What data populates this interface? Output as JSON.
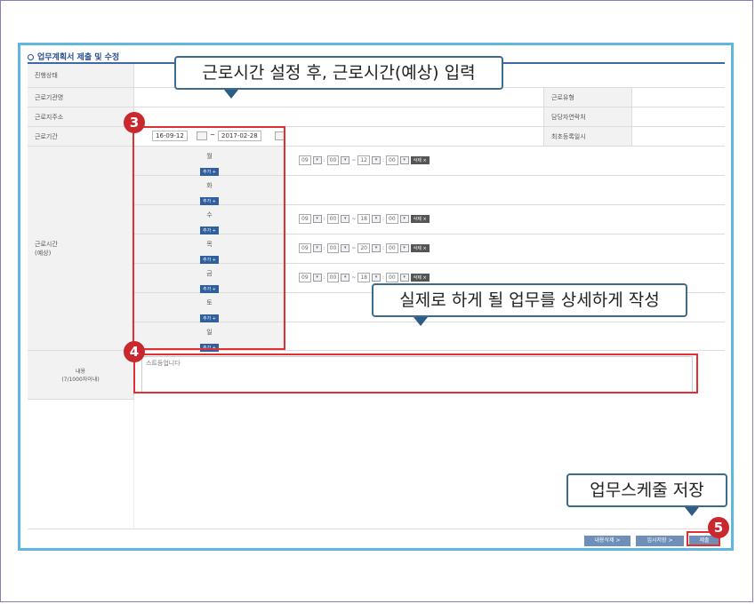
{
  "section": {
    "title": "업무계획서 제출 및 수정"
  },
  "fields": {
    "progress_status": "진행상태",
    "workplace_name": "근로기관명",
    "work_type": "근로유형",
    "workplace_address": "근로지주소",
    "manager_contact": "담당자연락처",
    "work_period": "근로기간",
    "first_registered": "최초등록일시",
    "work_hours_label": "근로시간\n(예상)",
    "content_label": "내용\n(7/1000자이내)"
  },
  "period": {
    "start": "16-09-12",
    "separator": "~",
    "end": "2017-02-28"
  },
  "days": [
    {
      "name": "월",
      "add": "추가 +",
      "times": [
        "09",
        "00",
        "12",
        "00"
      ],
      "delete": "삭제 ×"
    },
    {
      "name": "화",
      "add": "추가 +"
    },
    {
      "name": "수",
      "add": "추가 +",
      "times": [
        "09",
        "00",
        "18",
        "00"
      ],
      "delete": "삭제 ×"
    },
    {
      "name": "목",
      "add": "추가 +",
      "times": [
        "09",
        "00",
        "20",
        "00"
      ],
      "delete": "삭제 ×"
    },
    {
      "name": "금",
      "add": "추가 +",
      "times": [
        "09",
        "00",
        "18",
        "00"
      ],
      "delete": "삭제 ×"
    },
    {
      "name": "토",
      "add": "추가 +"
    },
    {
      "name": "일",
      "add": "추가 +"
    }
  ],
  "time_sep": {
    "colon": ":",
    "range": "~"
  },
  "content": {
    "value": "스트등업니다"
  },
  "buttons": {
    "delete_content": "내용삭제 >",
    "temp_save": "임시저장 >",
    "submit": "제출"
  },
  "callouts": {
    "c1": "근로시간 설정 후, 근로시간(예상) 입력",
    "c2": "실제로 하게 될 업무를 상세하게 작성",
    "c3": "업무스케줄 저장"
  },
  "badges": {
    "b3": "3",
    "b4": "4",
    "b5": "5"
  },
  "colors": {
    "accent": "#c8282e",
    "frame": "#5fb7e0",
    "callout_border": "#3b6c8e"
  }
}
